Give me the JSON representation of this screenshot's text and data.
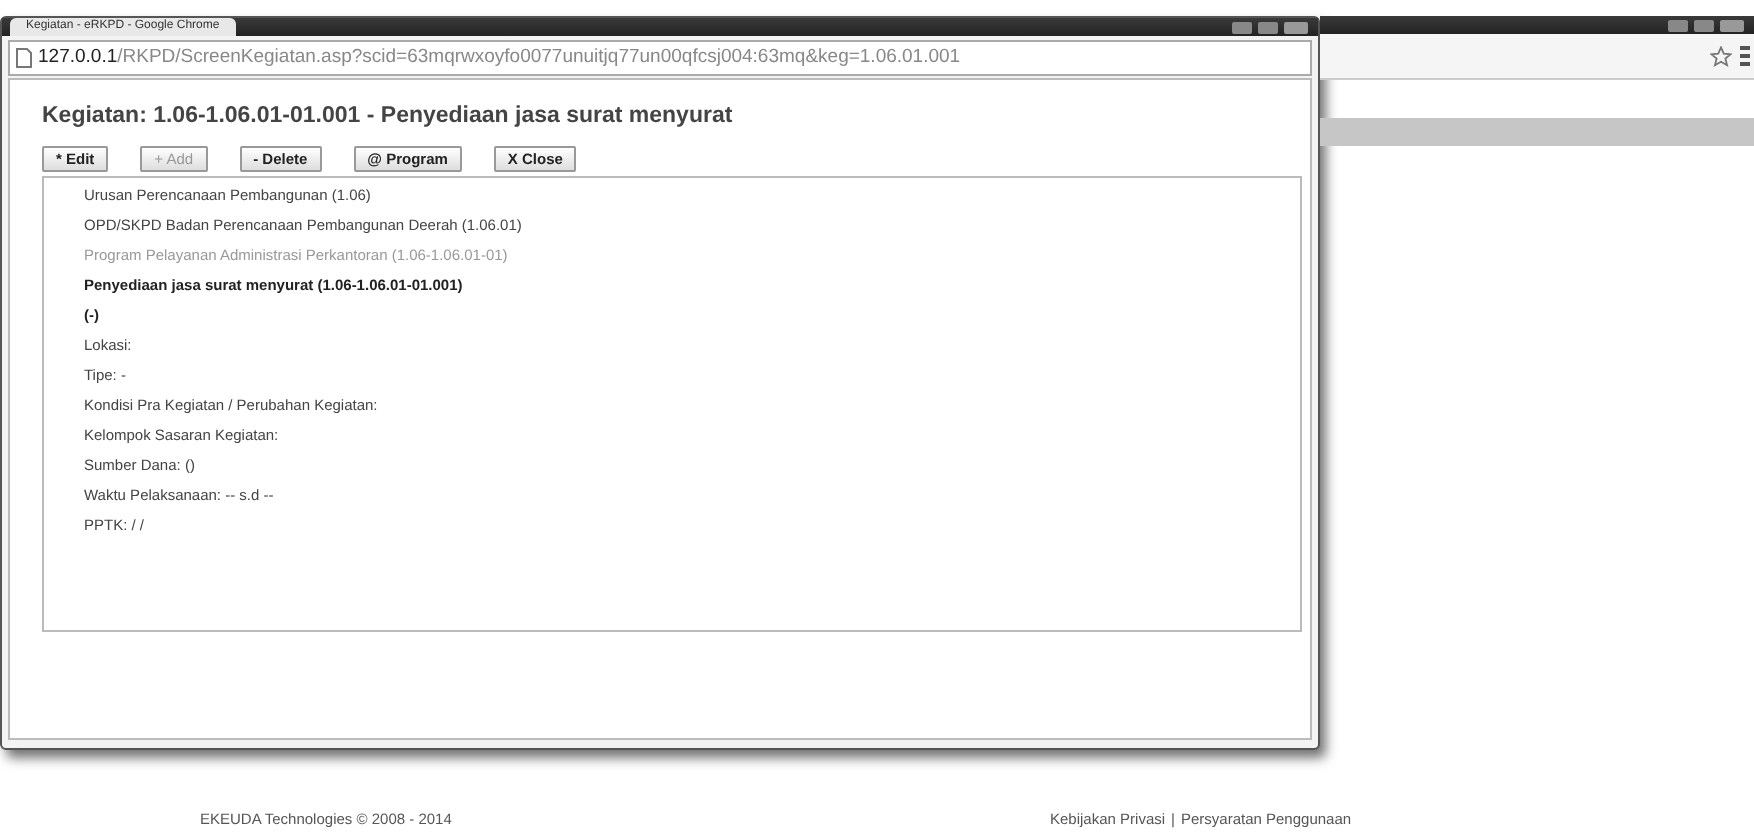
{
  "popup": {
    "title": "Kegiatan - eRKPD - Google Chrome",
    "url_host": "127.0.0.1",
    "url_path": "/RKPD/ScreenKegiatan.asp?scid=63mqrwxoyfo0077unuitjq77un00qfcsj004:63mq&keg=1.06.01.001",
    "heading": "Kegiatan: 1.06-1.06.01-01.001 - Penyediaan jasa surat menyurat",
    "buttons": [
      {
        "label": "* Edit",
        "disabled": false
      },
      {
        "label": "+ Add",
        "disabled": true
      },
      {
        "label": "- Delete",
        "disabled": false
      },
      {
        "label": "@ Program",
        "disabled": false
      },
      {
        "label": "X Close",
        "disabled": false
      }
    ],
    "details": [
      {
        "text": "Urusan Perencanaan Pembangunan (1.06)",
        "kind": "normal"
      },
      {
        "text": "OPD/SKPD Badan Perencanaan Pembangunan Deerah (1.06.01)",
        "kind": "normal"
      },
      {
        "text": "Program Pelayanan Administrasi Perkantoran (1.06-1.06.01-01)",
        "kind": "muted"
      },
      {
        "text": "Penyediaan jasa surat menyurat (1.06-1.06.01-01.001)",
        "kind": "bold"
      },
      {
        "text": "(-)",
        "kind": "bold"
      },
      {
        "text": "Lokasi:",
        "kind": "normal"
      },
      {
        "text": "Tipe: -",
        "kind": "normal"
      },
      {
        "text": "Kondisi Pra Kegiatan / Perubahan Kegiatan:",
        "kind": "normal"
      },
      {
        "text": "Kelompok Sasaran Kegiatan:",
        "kind": "normal"
      },
      {
        "text": "Sumber Dana: ()",
        "kind": "normal"
      },
      {
        "text": "Waktu Pelaksanaan: -- s.d --",
        "kind": "normal"
      },
      {
        "text": "PPTK: / /",
        "kind": "normal"
      }
    ]
  },
  "footer": {
    "copyright": "EKEUDA Technologies © 2008 - 2014",
    "links": [
      "Kebijakan Privasi",
      "Persyaratan Penggunaan"
    ],
    "separator": "|"
  }
}
